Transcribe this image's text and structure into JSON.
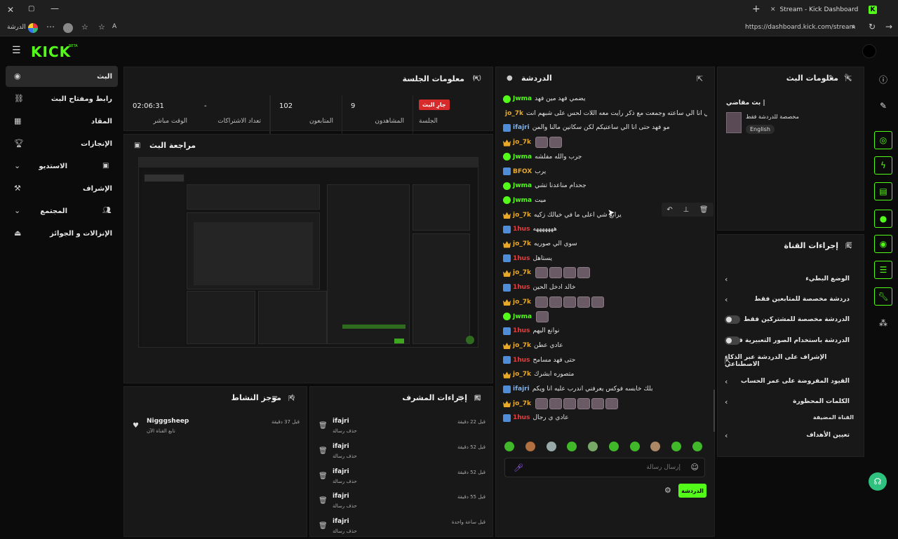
{
  "browser": {
    "tab_title": "Stream - Kick Dashboard",
    "url": "https://dashboard.kick.com/stream",
    "profile_label": "الدرشة"
  },
  "app": {
    "logo": "KICK",
    "logo_badge": "BETA"
  },
  "sidebar": {
    "items": [
      {
        "label": "البث",
        "icon": "broadcast-icon"
      },
      {
        "label": "رابط ومفتاح البث",
        "icon": "link-icon"
      },
      {
        "label": "المقاد",
        "icon": "grid-icon"
      },
      {
        "label": "الإنجازات",
        "icon": "trophy-icon"
      },
      {
        "label": "الاستديو",
        "icon": "studio-icon"
      },
      {
        "label": "الإشراف",
        "icon": "gavel-icon"
      },
      {
        "label": "المجتمع",
        "icon": "community-icon"
      },
      {
        "label": "الإنزالات و الجوائز",
        "icon": "drops-icon"
      }
    ]
  },
  "session": {
    "title": "معلومات الجلسة",
    "live_badge": "جارِ البث",
    "session_label": "الجلسة",
    "stats": [
      {
        "value": "9",
        "label": "المشاهدون"
      },
      {
        "value": "102",
        "label": "المتابعون"
      },
      {
        "value": "-",
        "label": "تعداد الاشتراكات"
      },
      {
        "value": "02:06:31",
        "label": "الوقت مباشر"
      }
    ]
  },
  "preview": {
    "title": "مراجعة البث"
  },
  "activity": {
    "title": "موجز النشاط",
    "items": [
      {
        "name": "Nigggsheep",
        "desc": "تابع القناة الآن",
        "time": "قبل 37 دقيقة"
      }
    ]
  },
  "mod_actions": {
    "title": "إجراءات المشرف",
    "items": [
      {
        "name": "ifajri",
        "desc": "حذف رسالة",
        "time": "قبل 22 دقيقة"
      },
      {
        "name": "ifajri",
        "desc": "حذف رسالة",
        "time": "قبل 52 دقيقة"
      },
      {
        "name": "ifajri",
        "desc": "حذف رسالة",
        "time": "قبل 52 دقيقة"
      },
      {
        "name": "ifajri",
        "desc": "حذف رسالة",
        "time": "قبل 55 دقيقة"
      },
      {
        "name": "ifajri",
        "desc": "حذف رسالة",
        "time": "قبل ساعة واحدة"
      }
    ]
  },
  "chat": {
    "title": "الدردشة",
    "input_placeholder": "إرسال رسالة",
    "send_label": "الدردشة",
    "messages": [
      {
        "user": "Jwma",
        "badge": "ver",
        "color": "#53fc18",
        "text": "يضمي فهد مين فهد",
        "emotes": 0
      },
      {
        "user": "jo_7k",
        "badge": "vip",
        "color": "#e8a92b",
        "text": "ليش شي انا في حبيطنه ذكي شي انا الي ساعته وجمعت مع ذكر رايت معه اللات لحس على شبهم انت",
        "emotes": 3
      },
      {
        "user": "ifajri",
        "badge": "mod",
        "color": "#7fb0ea",
        "text": "مو فهد حتى انا الي ساعتيكم لكن سكانين مالنا والمن",
        "emotes": 0
      },
      {
        "user": "jo_7k",
        "badge": "vip",
        "color": "#e8a92b",
        "text": "",
        "emotes": 2
      },
      {
        "user": "Jwma",
        "badge": "ver",
        "color": "#53fc18",
        "text": "جرب والله مفلشه",
        "emotes": 0
      },
      {
        "user": "BFOX",
        "badge": "mod",
        "color": "#e8a92b",
        "text": "يرب",
        "emotes": 0
      },
      {
        "user": "Jwma",
        "badge": "ver",
        "color": "#53fc18",
        "text": "جحدام مناعدنا تشي",
        "emotes": 0
      },
      {
        "user": "Jwma",
        "badge": "ver",
        "color": "#53fc18",
        "text": "ميت",
        "emotes": 0
      },
      {
        "user": "jo_7k",
        "badge": "vip",
        "color": "#e8a92b",
        "text": "يرابع شي اعلى ما في خيالك زكيه",
        "emotes": 0
      },
      {
        "user": "1hus",
        "badge": "mod",
        "color": "#e04040",
        "text": "هههههههه",
        "emotes": 0
      },
      {
        "user": "jo_7k",
        "badge": "vip",
        "color": "#e8a92b",
        "text": "سوي الي صوريه",
        "emotes": 0
      },
      {
        "user": "1hus",
        "badge": "mod",
        "color": "#e04040",
        "text": "يستاهل",
        "emotes": 0
      },
      {
        "user": "jo_7k",
        "badge": "vip",
        "color": "#e8a92b",
        "text": "",
        "emotes": 4
      },
      {
        "user": "1hus",
        "badge": "mod",
        "color": "#e04040",
        "text": "خالد ادخل الحين",
        "emotes": 0
      },
      {
        "user": "jo_7k",
        "badge": "vip",
        "color": "#e8a92b",
        "text": "",
        "emotes": 5
      },
      {
        "user": "Jwma",
        "badge": "ver",
        "color": "#53fc18",
        "text": "",
        "emotes": 1
      },
      {
        "user": "1hus",
        "badge": "mod",
        "color": "#e04040",
        "text": "نوانع اليهم",
        "emotes": 0
      },
      {
        "user": "jo_7k",
        "badge": "vip",
        "color": "#e8a92b",
        "text": "عادي عطن",
        "emotes": 0
      },
      {
        "user": "1hus",
        "badge": "mod",
        "color": "#e04040",
        "text": "حتى فهد مسامح",
        "emotes": 0
      },
      {
        "user": "jo_7k",
        "badge": "vip",
        "color": "#e8a92b",
        "text": "متصوره ابشرك",
        "emotes": 0
      },
      {
        "user": "ifajri",
        "badge": "mod",
        "color": "#7fb0ea",
        "text": "بلك خابسه فوكس يعرفني اندرب عليه انا ويكم",
        "emotes": 0
      },
      {
        "user": "jo_7k",
        "badge": "vip",
        "color": "#e8a92b",
        "text": "",
        "emotes": 6
      },
      {
        "user": "1hus",
        "badge": "mod",
        "color": "#e04040",
        "text": "عادي ي رجال",
        "emotes": 0
      }
    ]
  },
  "stream_info": {
    "title": "معلومات البث",
    "stream_title": "بث مقاضي |",
    "tag_line": "مخصصة للدردشة فقط",
    "language": "English"
  },
  "channel_actions": {
    "title": "إجراءات القناة",
    "rows": [
      {
        "label": "الوضع البطيء",
        "kind": "arrow"
      },
      {
        "label": "دردشة مخصصة للمتابعين فقط",
        "kind": "arrow"
      },
      {
        "label": "الدردشة مخصصة للمشتركين فقط",
        "kind": "toggle"
      },
      {
        "label": "الدردشة باستخدام الصور التعبيرية فقط",
        "kind": "toggle"
      },
      {
        "label": "الإشراف على الدردشة عبر الذكاء الاصطناعي",
        "kind": "link"
      },
      {
        "label": "القيود المفروضة على عمر الحساب",
        "kind": "arrow"
      },
      {
        "label": "الكلمات المحظورة",
        "kind": "arrow"
      }
    ],
    "featured_label": "القناة المضيفة",
    "goal_label": "تعيين الأهداف"
  }
}
